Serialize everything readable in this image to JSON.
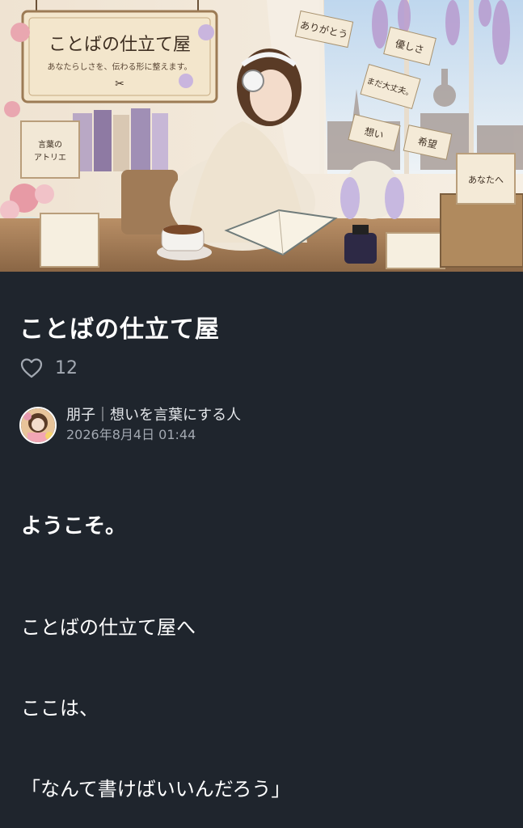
{
  "hero": {
    "shop_sign_title": "ことばの仕立て屋",
    "shop_sign_subtitle": "あなたらしさを、伝わる形に整えます。",
    "tags": [
      "ありがとう",
      "優しさ",
      "まだ大丈夫。",
      "想い",
      "希望"
    ],
    "card_atelier": "言葉の\nアトリエ",
    "card_right": "あなたへ"
  },
  "post": {
    "title": "ことばの仕立て屋",
    "like_count": "12",
    "author_name": "朋子｜想いを言葉にする人",
    "date": "2026年8月4日 01:44"
  },
  "body": {
    "greeting": "ようこそ。",
    "paragraph1": "ことばの仕立て屋へ",
    "paragraph2": "ここは、",
    "paragraph3": "「なんて書けばいいんだろう」"
  },
  "colors": {
    "background": "#1f252d",
    "text": "#ffffff",
    "muted": "#a3a9b2"
  }
}
